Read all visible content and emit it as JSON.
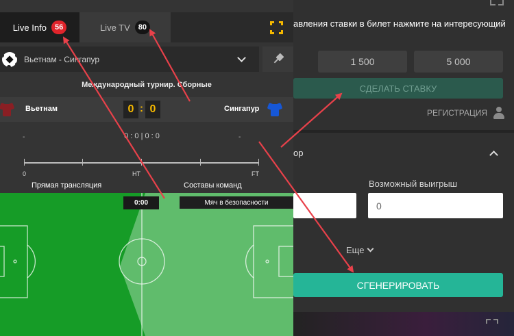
{
  "bet_panel": {
    "hint_text": "авления ставки в билет нажмите на интересующий",
    "amounts": [
      "1 500",
      "5 000"
    ],
    "make_bet_label": "СДЕЛАТЬ СТАВКУ",
    "register_label": "РЕГИСТРАЦИЯ",
    "section_label": "ор",
    "possible_win_label": "Возможный выигрыш",
    "stake_value": "",
    "possible_win_value": "0",
    "more_label": "Еще",
    "generate_label": "СГЕНЕРИРОВАТЬ"
  },
  "widget": {
    "tabs": [
      {
        "label": "Live Info",
        "count": "56"
      },
      {
        "label": "Live TV",
        "count": "80"
      }
    ],
    "match_select": {
      "value": "Вьетнам - Сингапур"
    },
    "tournament": "Международный турнир. Сборные",
    "home_team": "Вьетнам",
    "away_team": "Сингапур",
    "home_score": "0",
    "score_separator": ":",
    "away_score": "0",
    "stat_left": "-",
    "stat_center": "0 : 0 | 0 : 0",
    "stat_right": "-",
    "timeline_labels": {
      "start": "0",
      "half": "HT",
      "full": "FT"
    },
    "link_stream": "Прямая трансляция",
    "link_lineups": "Составы команд",
    "match_clock": "0:00",
    "status_banner": "Мяч в безопасности"
  },
  "colors": {
    "accent_yellow": "#f5b800",
    "badge_red": "#e0242b",
    "generate_green": "#25b597",
    "pitch_green": "#169c27",
    "arrow_red": "#e8414a"
  }
}
